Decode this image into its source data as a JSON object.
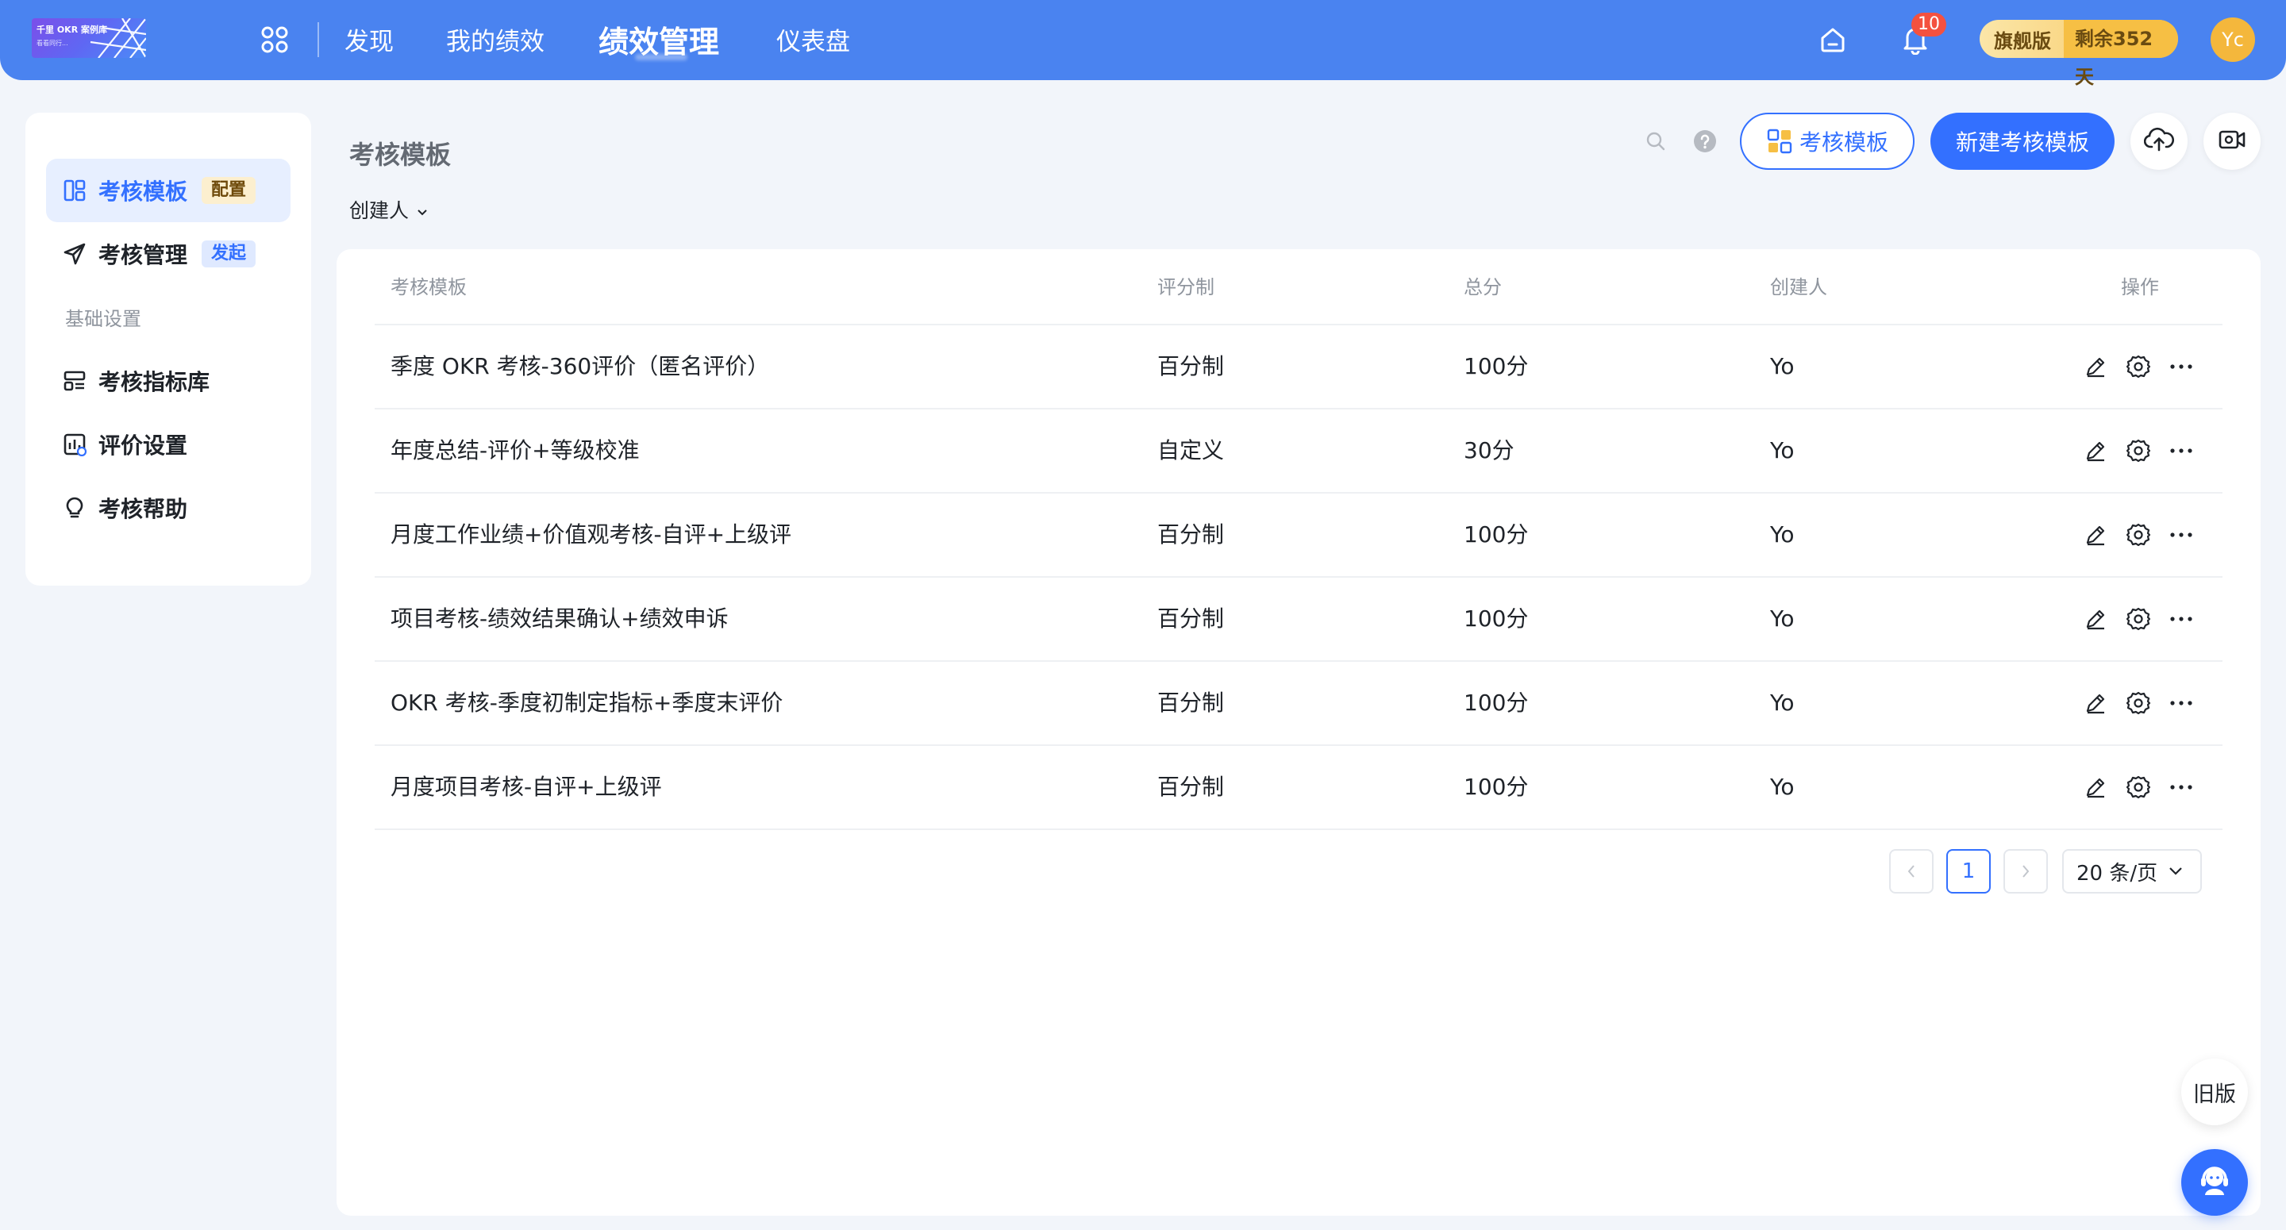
{
  "app": {
    "logo_text": "千里 OKR 案例库",
    "logo_sub": "看看同行..."
  },
  "topnav": {
    "items": [
      {
        "label": "发现"
      },
      {
        "label": "我的绩效"
      },
      {
        "label": "绩效管理"
      },
      {
        "label": "仪表盘"
      }
    ],
    "active_index": 2,
    "notification_count": "10",
    "plan_name": "旗舰版",
    "plan_remaining": "剩余352天",
    "avatar_initials": "Yc"
  },
  "sidebar": {
    "items": [
      {
        "label": "考核模板",
        "tag": "配置"
      },
      {
        "label": "考核管理",
        "tag": "发起"
      },
      {
        "label": "考核指标库"
      },
      {
        "label": "评价设置"
      },
      {
        "label": "考核帮助"
      }
    ],
    "section_label": "基础设置",
    "active_index": 0
  },
  "main": {
    "page_title": "考核模板",
    "filter_label": "创建人",
    "template_button": "考核模板",
    "new_button": "新建考核模板"
  },
  "table": {
    "headers": [
      "考核模板",
      "评分制",
      "总分",
      "创建人",
      "操作"
    ],
    "rows": [
      {
        "name": "季度 OKR 考核-360评价（匿名评价）",
        "scoring": "百分制",
        "total": "100分",
        "creator": "Yo"
      },
      {
        "name": "年度总结-评价+等级校准",
        "scoring": "自定义",
        "total": "30分",
        "creator": "Yo"
      },
      {
        "name": "月度工作业绩+价值观考核-自评+上级评",
        "scoring": "百分制",
        "total": "100分",
        "creator": "Yo"
      },
      {
        "name": "项目考核-绩效结果确认+绩效申诉",
        "scoring": "百分制",
        "total": "100分",
        "creator": "Yo"
      },
      {
        "name": "OKR 考核-季度初制定指标+季度末评价",
        "scoring": "百分制",
        "total": "100分",
        "creator": "Yo"
      },
      {
        "name": "月度项目考核-自评+上级评",
        "scoring": "百分制",
        "total": "100分",
        "creator": "Yo"
      }
    ]
  },
  "pagination": {
    "current_page": "1",
    "page_size": "20 条/页"
  },
  "floating": {
    "old_version": "旧版"
  },
  "colors": {
    "topbar": "#4a83f0",
    "accent": "#3370ff",
    "plan_gold": "#f6bf44",
    "badge_red": "#f4513f"
  }
}
